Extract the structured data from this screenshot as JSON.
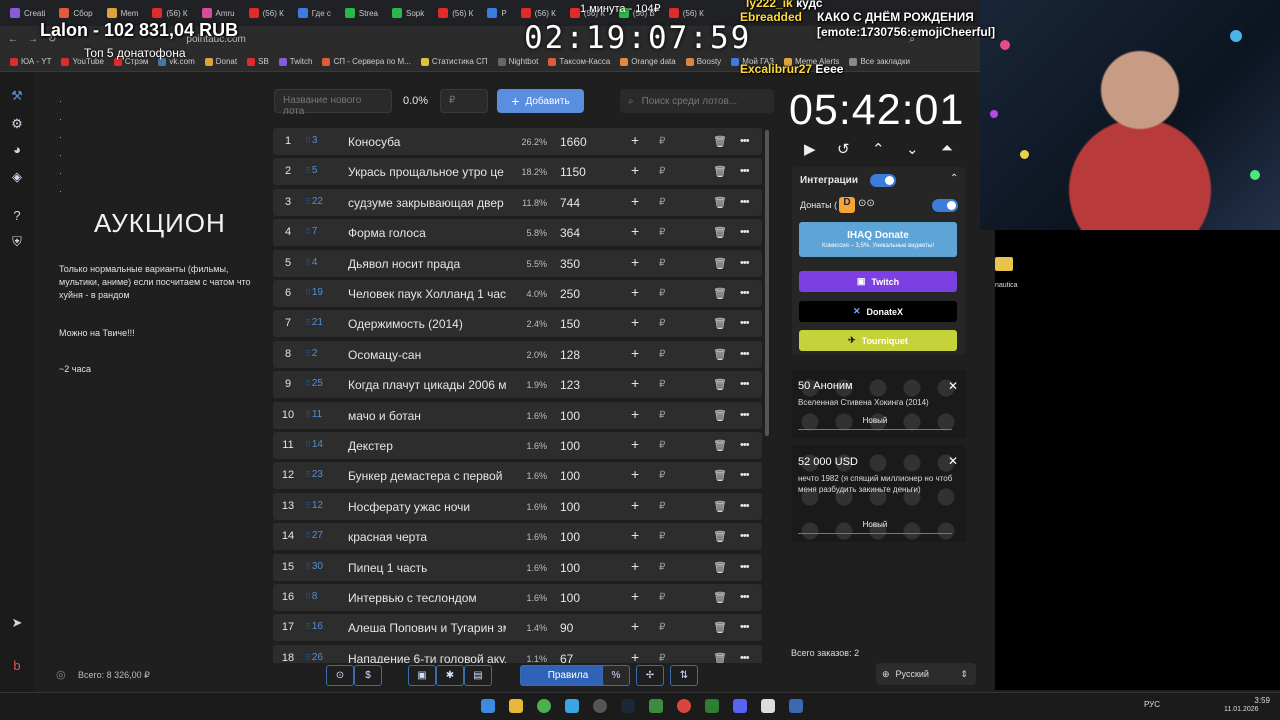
{
  "browser": {
    "tabs": [
      "Creati",
      "Сбор",
      "Mem",
      "(56) К",
      "Amru",
      "(56) К",
      "Где с",
      "Strea",
      "Sopk",
      "(56) К",
      "P",
      "(56) К",
      "(56) К",
      "(56) В",
      "(56) К"
    ],
    "url": "pointauc.com",
    "bookmarks": [
      "ЮА - YT",
      "YouTube",
      "Стрэм",
      "vk.com",
      "Donat",
      "SB",
      "Twitch",
      "СП - Сервера по М...",
      "Статистика СП",
      "Nightbot",
      "Таксом-Касса",
      "Orange data",
      "Boosty",
      "Мой ГАЗ",
      "Meme Alerts",
      "Все закладки"
    ]
  },
  "overlay": {
    "title": "Lalon - 102 831,04 RUB",
    "subtitle": "Топ 5 донатофона",
    "stream_timer": "02:19:07:59",
    "minute_label": "1 минута - 104₽",
    "chat": [
      {
        "nick": "ly222_ik",
        "text": "кудс"
      },
      {
        "nick": "Ebreadded",
        "text": "КАКО С ДНЁМ РОЖДЕНИЯ [emote:1730756:emojiCheerful]"
      },
      {
        "nick": "Excalibrur27",
        "text": "Eeee"
      }
    ]
  },
  "sidebar": {
    "title": "АУКЦИОН",
    "description": "Только нормальные варианты (фильмы, мультики, аниме) если посчитаем с чатом что хуйня - в рандом",
    "twitch_line": "Можно на  Твиче!!!",
    "duration": "~2 часа",
    "total_label": "Всего:",
    "total_value": "8 326,00 ₽"
  },
  "controls": {
    "new_lot_placeholder": "Название нового лота",
    "percent": "0.0%",
    "amount_placeholder": "₽",
    "add_label": "Добавить",
    "search_placeholder": "Поиск среди лотов..."
  },
  "lots": [
    {
      "n": "1",
      "id": "3",
      "name": "Коносуба",
      "pct": "26.2%",
      "amount": "1660"
    },
    {
      "n": "2",
      "id": "5",
      "name": "Укрась прощальное утро це",
      "pct": "18.2%",
      "amount": "1150"
    },
    {
      "n": "3",
      "id": "22",
      "name": "судзуме закрывающая двер",
      "pct": "11.8%",
      "amount": "744"
    },
    {
      "n": "4",
      "id": "7",
      "name": "Форма голоса",
      "pct": "5.8%",
      "amount": "364"
    },
    {
      "n": "5",
      "id": "4",
      "name": "Дьявол носит прада",
      "pct": "5.5%",
      "amount": "350"
    },
    {
      "n": "6",
      "id": "19",
      "name": "Человек паук Холланд 1 част",
      "pct": "4.0%",
      "amount": "250"
    },
    {
      "n": "7",
      "id": "21",
      "name": "Одержимость (2014)",
      "pct": "2.4%",
      "amount": "150"
    },
    {
      "n": "8",
      "id": "2",
      "name": "Осомацу-сан",
      "pct": "2.0%",
      "amount": "128"
    },
    {
      "n": "9",
      "id": "25",
      "name": "Когда плачут цикады 2006 м",
      "pct": "1.9%",
      "amount": "123"
    },
    {
      "n": "10",
      "id": "11",
      "name": "мачо и ботан",
      "pct": "1.6%",
      "amount": "100"
    },
    {
      "n": "11",
      "id": "14",
      "name": "Декстер",
      "pct": "1.6%",
      "amount": "100"
    },
    {
      "n": "12",
      "id": "23",
      "name": "Бункер демастера с первой",
      "pct": "1.6%",
      "amount": "100"
    },
    {
      "n": "13",
      "id": "12",
      "name": "Носферату ужас ночи",
      "pct": "1.6%",
      "amount": "100"
    },
    {
      "n": "14",
      "id": "27",
      "name": "красная черта",
      "pct": "1.6%",
      "amount": "100"
    },
    {
      "n": "15",
      "id": "30",
      "name": "Пипец 1 часть",
      "pct": "1.6%",
      "amount": "100"
    },
    {
      "n": "16",
      "id": "8",
      "name": "Интервью с теслондом",
      "pct": "1.6%",
      "amount": "100"
    },
    {
      "n": "17",
      "id": "16",
      "name": "Алеша Попович и Тугарин зм",
      "pct": "1.4%",
      "amount": "90"
    },
    {
      "n": "18",
      "id": "26",
      "name": "Нападение 6-ти головой акул",
      "pct": "1.1%",
      "amount": "67"
    }
  ],
  "toolbar": {
    "rules_label": "Правила",
    "percent_icon": "%"
  },
  "right": {
    "clock": "05:42:01",
    "integrations_label": "Интеграции",
    "donations_label": "Донаты (",
    "ihaq_label": "IHAQ Donate",
    "ihaq_sub": "Комиссия – 3,5%. Уникальные виджеты!",
    "twitch_label": "Twitch",
    "donatex_label": "DonateX",
    "tourniquet_label": "Tourniquet",
    "donations": [
      {
        "amount": "50 Аноним",
        "message": "Вселенная Стивена Хокинга (2014)",
        "status": "Новый"
      },
      {
        "amount": "52 000 USD",
        "message": "нечто 1982 (я спящий миллионер но чтоб меня разбудить закиньте деньги)",
        "status": "Новый"
      }
    ],
    "orders_label": "Всего заказов:",
    "orders_count": "2",
    "language": "Русский"
  },
  "desktop": {
    "icon_label": "nautica"
  },
  "taskbar": {
    "lang": "РУС",
    "time": "3:59",
    "date": "11.01.2026"
  },
  "colors": {
    "accent": "#5a8fe0",
    "twitch": "#7b3fe4",
    "tourniquet": "#c6d23a",
    "ihaq": "#5fa4d6"
  }
}
